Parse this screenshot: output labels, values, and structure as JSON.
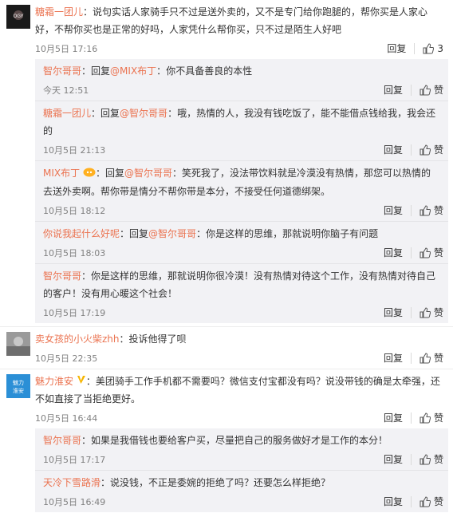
{
  "ui": {
    "reply_label": "回复",
    "like_label": "赞",
    "colon": "：",
    "reply_prefix": "回复",
    "at": "@"
  },
  "comments": [
    {
      "user": "糖霜一团儿",
      "text": "说句实话人家骑手只不过是送外卖的，又不是专门给你跑腿的，帮你买是人家心好，不帮你买也是正常的好吗，人家凭什么帮你买，只不过是陌生人好吧",
      "time": "10月5日 17:16",
      "like_count": "3",
      "replies": [
        {
          "user": "智尔哥哥",
          "reply_to": "MIX布丁",
          "text": "你不具备善良的本性",
          "time": "今天 12:51"
        },
        {
          "user": "糖霜一团儿",
          "reply_to": "智尔哥哥",
          "text": "哦，热情的人，我没有钱吃饭了，能不能借点钱给我，我会还的",
          "time": "10月5日 21:13"
        },
        {
          "user": "MIX布丁",
          "reply_to": "智尔哥哥",
          "text": "笑死我了，没法带饮料就是冷漠没有热情，那您可以热情的去送外卖啊。帮你带是情分不帮你带是本分，不接受任何道德绑架。",
          "time": "10月5日 18:12"
        },
        {
          "user": "你说我起什么好呢",
          "reply_to": "智尔哥哥",
          "text": "你是这样的思维，那就说明你脑子有问题",
          "time": "10月5日 18:03"
        },
        {
          "user": "智尔哥哥",
          "reply_to": "",
          "text": "你是这样的思维，那就说明你很冷漠！没有热情对待这个工作，没有热情对待自己的客户！没有用心暖这个社会！",
          "time": "10月5日 17:19"
        }
      ]
    },
    {
      "user": "卖女孩的小火柴zhh",
      "text": "投诉他得了呗",
      "time": "10月5日 22:35",
      "replies": []
    },
    {
      "user": "魅力淮安",
      "text": "美团骑手工作手机都不需要吗？微信支付宝都没有吗？说没带钱的确是太牵强，还不如直接了当拒绝更好。",
      "time": "10月5日 16:44",
      "avatar_text": "魅力淮安",
      "replies": [
        {
          "user": "智尔哥哥",
          "reply_to": "",
          "text": "如果是我借钱也要给客户买，尽量把自己的服务做好才是工作的本分！",
          "time": "10月5日 17:17"
        },
        {
          "user": "天冷下雪路滑",
          "reply_to": "",
          "text": "说没钱，不正是委婉的拒绝了吗？还要怎么样拒绝？",
          "time": "10月5日 16:49"
        }
      ]
    }
  ],
  "colors": {
    "link": "#eb7350",
    "reply_bg": "#f2f2f5",
    "gray": "#808080"
  }
}
